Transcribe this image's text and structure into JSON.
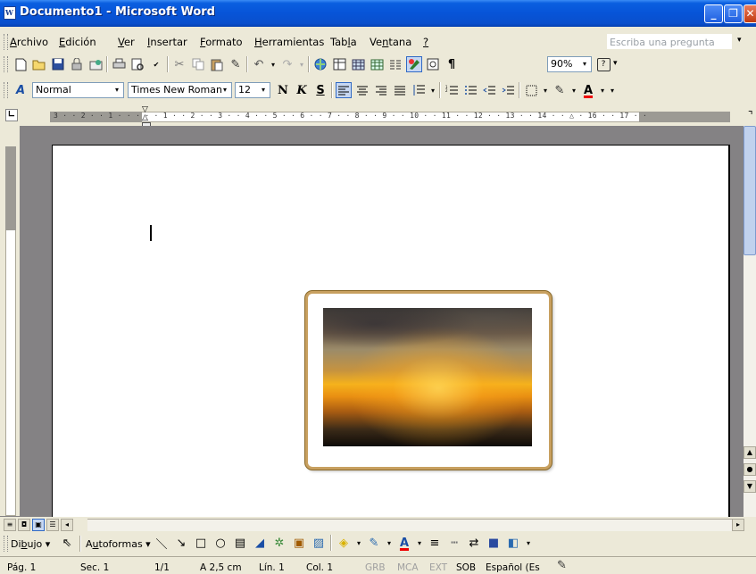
{
  "window": {
    "title": "Documento1 - Microsoft Word",
    "minimize": "_",
    "maximize": "❐",
    "close": "✕"
  },
  "menu": {
    "items": [
      {
        "pre": "",
        "key": "A",
        "post": "rchivo"
      },
      {
        "pre": "",
        "key": "E",
        "post": "dición"
      },
      {
        "pre": "",
        "key": "V",
        "post": "er"
      },
      {
        "pre": "",
        "key": "I",
        "post": "nsertar"
      },
      {
        "pre": "",
        "key": "F",
        "post": "ormato"
      },
      {
        "pre": "",
        "key": "H",
        "post": "erramientas"
      },
      {
        "pre": "Tab",
        "key": "l",
        "post": "a"
      },
      {
        "pre": "Ve",
        "key": "n",
        "post": "tana"
      },
      {
        "pre": "",
        "key": "?",
        "post": ""
      }
    ],
    "ask_placeholder": "Escriba una pregunta"
  },
  "standard_toolbar": {
    "icons": [
      "new-icon",
      "open-icon",
      "save-icon",
      "permission-icon",
      "email-icon",
      "print-icon",
      "print-preview-icon",
      "spelling-icon",
      "cut-icon",
      "copy-icon",
      "paste-icon",
      "format-painter-icon",
      "undo-icon",
      "redo-icon",
      "hyperlink-icon",
      "tables-borders-icon",
      "insert-table-icon",
      "insert-excel-icon",
      "columns-icon",
      "drawing-icon",
      "document-map-icon",
      "show-formatting-icon"
    ],
    "zoom": "90%",
    "help_glyph": "?"
  },
  "format_toolbar": {
    "style": "Normal",
    "font": "Times New Roman",
    "size": "12",
    "bold": "N",
    "italic": "K",
    "underline": "S"
  },
  "ruler": {
    "h_text": "3 · · 2 · · 1 · · ·  · · 1 · · 2 · · 3 · · 4 · · 5 · · 6 · · 7 · · 8 · · 9 · · 10 · · 11 · · 12 · · 13 · · 14 · · △ · 16 · · 17 · ·"
  },
  "drawing_toolbar": {
    "draw_pre": "Di",
    "draw_key": "b",
    "draw_post": "ujo",
    "autoshapes_pre": "A",
    "autoshapes_key": "u",
    "autoshapes_post": "toformas"
  },
  "status": {
    "page": "Pág. 1",
    "section": "Sec. 1",
    "pages": "1/1",
    "at": "A 2,5 cm",
    "line": "Lín. 1",
    "col": "Col. 1",
    "grb": "GRB",
    "mca": "MCA",
    "ext": "EXT",
    "sob": "SOB",
    "lang": "Español (Es"
  },
  "colors": {
    "title_bar": "#0754d8",
    "frame": "#c8a060",
    "chrome": "#ece9d8"
  }
}
